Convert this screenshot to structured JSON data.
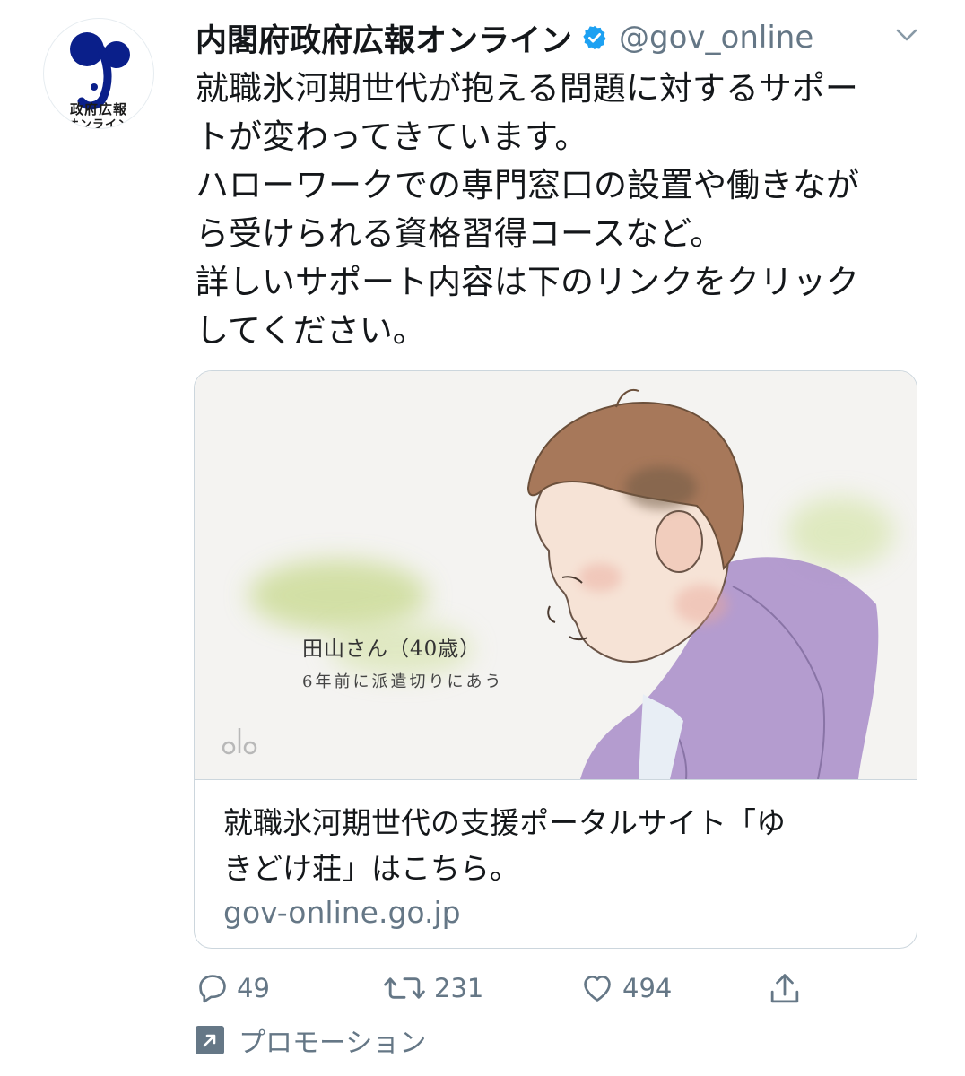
{
  "account": {
    "avatar_line1": "政府広報",
    "avatar_line2": "オンライン",
    "display_name": "内閣府政府広報オンライン",
    "handle": "@gov_online"
  },
  "tweet": {
    "lines": [
      "就職氷河期世代が抱える問題に対するサポー",
      "トが変わってきています。",
      "ハローワークでの専門窓口の設置や働きなが",
      "ら受けられる資格習得コースなど。",
      "詳しいサポート内容は下のリンクをクリック",
      "してください。"
    ]
  },
  "card": {
    "caption_name": "田山さん（40歳）",
    "caption_desc": "6年前に派遣切りにあう",
    "title_lines": [
      "就職氷河期世代の支援ポータルサイト「ゆ",
      "きどけ荘」はこちら。"
    ],
    "domain": "gov-online.go.jp"
  },
  "actions": {
    "replies": "49",
    "retweets": "231",
    "likes": "494"
  },
  "promo_label": "プロモーション",
  "colors": {
    "text": "#14171a",
    "secondary": "#657786",
    "verified": "#1da1f2",
    "logo_navy": "#0a1f8a",
    "border": "#ccd6dd"
  }
}
